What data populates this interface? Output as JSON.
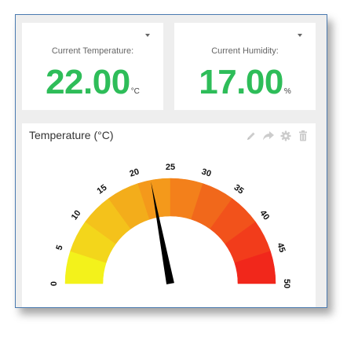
{
  "temperature_card": {
    "label": "Current Temperature:",
    "value": "22.00",
    "unit": "°C"
  },
  "humidity_card": {
    "label": "Current Humidity:",
    "value": "17.00",
    "unit": "%"
  },
  "gauge_panel": {
    "title": "Temperature (°C)",
    "toolbar": [
      "pencil-icon",
      "share-icon",
      "gear-icon",
      "trash-icon"
    ]
  },
  "chart_data": {
    "type": "gauge",
    "min": 0,
    "max": 50,
    "value": 22,
    "tick_labels": [
      "0",
      "5",
      "10",
      "15",
      "20",
      "25",
      "30",
      "35",
      "40",
      "45",
      "50"
    ],
    "band_colors": [
      "#f3f21b",
      "#f3d61b",
      "#f4c21b",
      "#f3ad1b",
      "#f4991b",
      "#f3801b",
      "#f1681b",
      "#f2521b",
      "#f23c1b",
      "#f1271b"
    ]
  },
  "colors": {
    "value_green": "#2ebd59",
    "needle": "#000000",
    "window_border": "#4a7ab0"
  }
}
